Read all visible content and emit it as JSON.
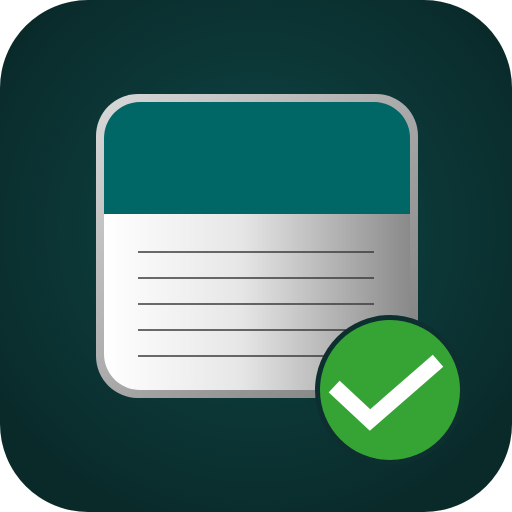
{
  "app_icon": {
    "background": {
      "inner_color": "#0f4848",
      "outer_color": "#0a2a2a"
    },
    "note_card": {
      "header_color": "#006766",
      "body_light": "#ffffff",
      "body_dark": "#8a8a8a",
      "line_color": "#3a3a3a",
      "line_count": 5
    },
    "badge": {
      "icon": "checkmark-icon",
      "color": "#36a435",
      "ring_color": "#0e2f2f",
      "check_color": "#ffffff"
    }
  }
}
